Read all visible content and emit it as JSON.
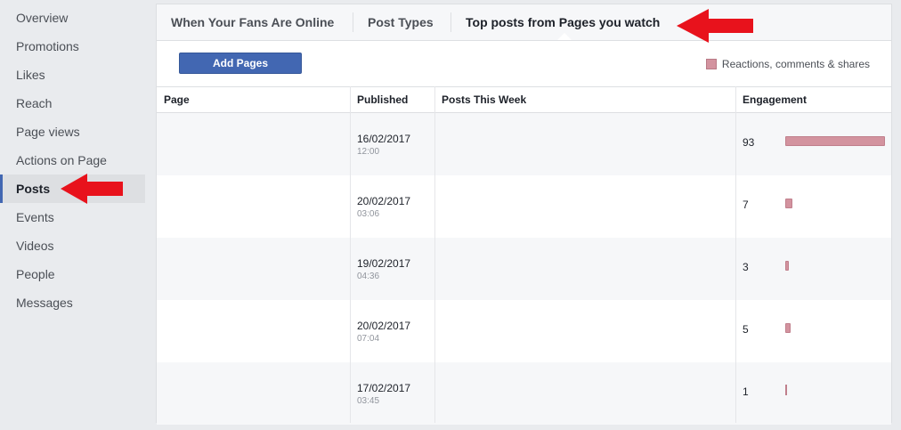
{
  "sidebar": {
    "items": [
      {
        "label": "Overview"
      },
      {
        "label": "Promotions"
      },
      {
        "label": "Likes"
      },
      {
        "label": "Reach"
      },
      {
        "label": "Page views"
      },
      {
        "label": "Actions on Page"
      },
      {
        "label": "Posts",
        "active": true
      },
      {
        "label": "Events"
      },
      {
        "label": "Videos"
      },
      {
        "label": "People"
      },
      {
        "label": "Messages"
      }
    ]
  },
  "tabs": [
    {
      "label": "When Your Fans Are Online"
    },
    {
      "label": "Post Types"
    },
    {
      "label": "Top posts from Pages you watch",
      "active": true
    }
  ],
  "toolbar": {
    "add_label": "Add Pages",
    "legend_label": "Reactions, comments & shares",
    "legend_color": "#d3939f"
  },
  "table": {
    "headers": {
      "page": "Page",
      "published": "Published",
      "posts_week": "Posts This Week",
      "engagement": "Engagement"
    },
    "max_engagement": 93,
    "rows": [
      {
        "date": "16/02/2017",
        "time": "12:00",
        "engagement": 93
      },
      {
        "date": "20/02/2017",
        "time": "03:06",
        "engagement": 7
      },
      {
        "date": "19/02/2017",
        "time": "04:36",
        "engagement": 3
      },
      {
        "date": "20/02/2017",
        "time": "07:04",
        "engagement": 5
      },
      {
        "date": "17/02/2017",
        "time": "03:45",
        "engagement": 1
      }
    ]
  },
  "colors": {
    "accent": "#4267b2",
    "bar": "#d3939f",
    "annotation_arrow": "#e8121c"
  },
  "icons": {
    "annotation": "red-arrow-icon"
  }
}
